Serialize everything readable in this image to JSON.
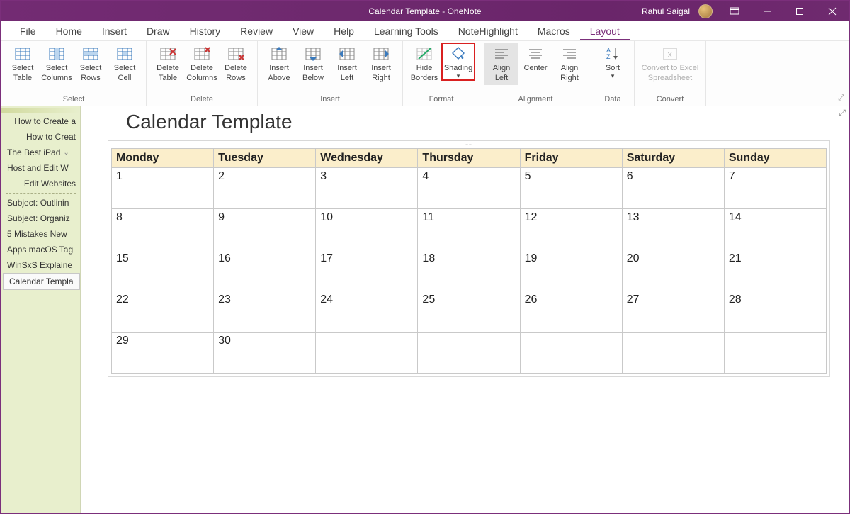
{
  "titlebar": {
    "document": "Calendar Template",
    "app": "OneNote",
    "separator": "  -  ",
    "username": "Rahul Saigal"
  },
  "menus": [
    "File",
    "Home",
    "Insert",
    "Draw",
    "History",
    "Review",
    "View",
    "Help",
    "Learning Tools",
    "NoteHighlight",
    "Macros",
    "Layout"
  ],
  "ribbon": {
    "groups": [
      {
        "label": "Select",
        "buttons": [
          {
            "name": "select-table",
            "line1": "Select",
            "line2": "Table"
          },
          {
            "name": "select-columns",
            "line1": "Select",
            "line2": "Columns"
          },
          {
            "name": "select-rows",
            "line1": "Select",
            "line2": "Rows"
          },
          {
            "name": "select-cell",
            "line1": "Select",
            "line2": "Cell"
          }
        ]
      },
      {
        "label": "Delete",
        "buttons": [
          {
            "name": "delete-table",
            "line1": "Delete",
            "line2": "Table"
          },
          {
            "name": "delete-columns",
            "line1": "Delete",
            "line2": "Columns"
          },
          {
            "name": "delete-rows",
            "line1": "Delete",
            "line2": "Rows"
          }
        ]
      },
      {
        "label": "Insert",
        "buttons": [
          {
            "name": "insert-above",
            "line1": "Insert",
            "line2": "Above"
          },
          {
            "name": "insert-below",
            "line1": "Insert",
            "line2": "Below"
          },
          {
            "name": "insert-left",
            "line1": "Insert",
            "line2": "Left"
          },
          {
            "name": "insert-right",
            "line1": "Insert",
            "line2": "Right"
          }
        ]
      },
      {
        "label": "Format",
        "buttons": [
          {
            "name": "hide-borders",
            "line1": "Hide",
            "line2": "Borders"
          },
          {
            "name": "shading",
            "line1": "Shading",
            "line2": "",
            "hasCaret": true,
            "highlighted": true
          }
        ]
      },
      {
        "label": "Alignment",
        "buttons": [
          {
            "name": "align-left",
            "line1": "Align",
            "line2": "Left",
            "selected": true
          },
          {
            "name": "center",
            "line1": "Center",
            "line2": ""
          },
          {
            "name": "align-right",
            "line1": "Align",
            "line2": "Right"
          }
        ]
      },
      {
        "label": "Data",
        "buttons": [
          {
            "name": "sort",
            "line1": "Sort",
            "line2": "",
            "hasCaret": true
          }
        ]
      },
      {
        "label": "Convert",
        "buttons": [
          {
            "name": "convert-to-excel",
            "line1": "Convert to Excel",
            "line2": "Spreadsheet",
            "disabled": true,
            "wide": true
          }
        ]
      }
    ]
  },
  "sidebar": {
    "items": [
      {
        "label": "How to Create a",
        "align": "right"
      },
      {
        "label": "How to Creat",
        "align": "right"
      },
      {
        "label": "The Best iPad",
        "align": "left",
        "caret": true
      },
      {
        "label": "Host and Edit W",
        "align": "left"
      },
      {
        "label": "Edit Websites",
        "align": "right"
      },
      {
        "sep": true
      },
      {
        "label": "Subject: Outlinin",
        "align": "left"
      },
      {
        "label": "Subject: Organiz",
        "align": "left"
      },
      {
        "label": "5 Mistakes New",
        "align": "left"
      },
      {
        "label": "Apps macOS Tag",
        "align": "left"
      },
      {
        "label": "WinSxS Explaine",
        "align": "left"
      },
      {
        "label": "Calendar Templa",
        "align": "left",
        "active": true
      }
    ]
  },
  "page": {
    "title": "Calendar Template",
    "calendar": {
      "headers": [
        "Monday",
        "Tuesday",
        "Wednesday",
        "Thursday",
        "Friday",
        "Saturday",
        "Sunday"
      ],
      "rows": [
        [
          "1",
          "2",
          "3",
          "4",
          "5",
          "6",
          "7"
        ],
        [
          "8",
          "9",
          "10",
          "11",
          "12",
          "13",
          "14"
        ],
        [
          "15",
          "16",
          "17",
          "18",
          "19",
          "20",
          "21"
        ],
        [
          "22",
          "23",
          "24",
          "25",
          "26",
          "27",
          "28"
        ],
        [
          "29",
          "30",
          "",
          "",
          "",
          "",
          ""
        ]
      ]
    }
  }
}
